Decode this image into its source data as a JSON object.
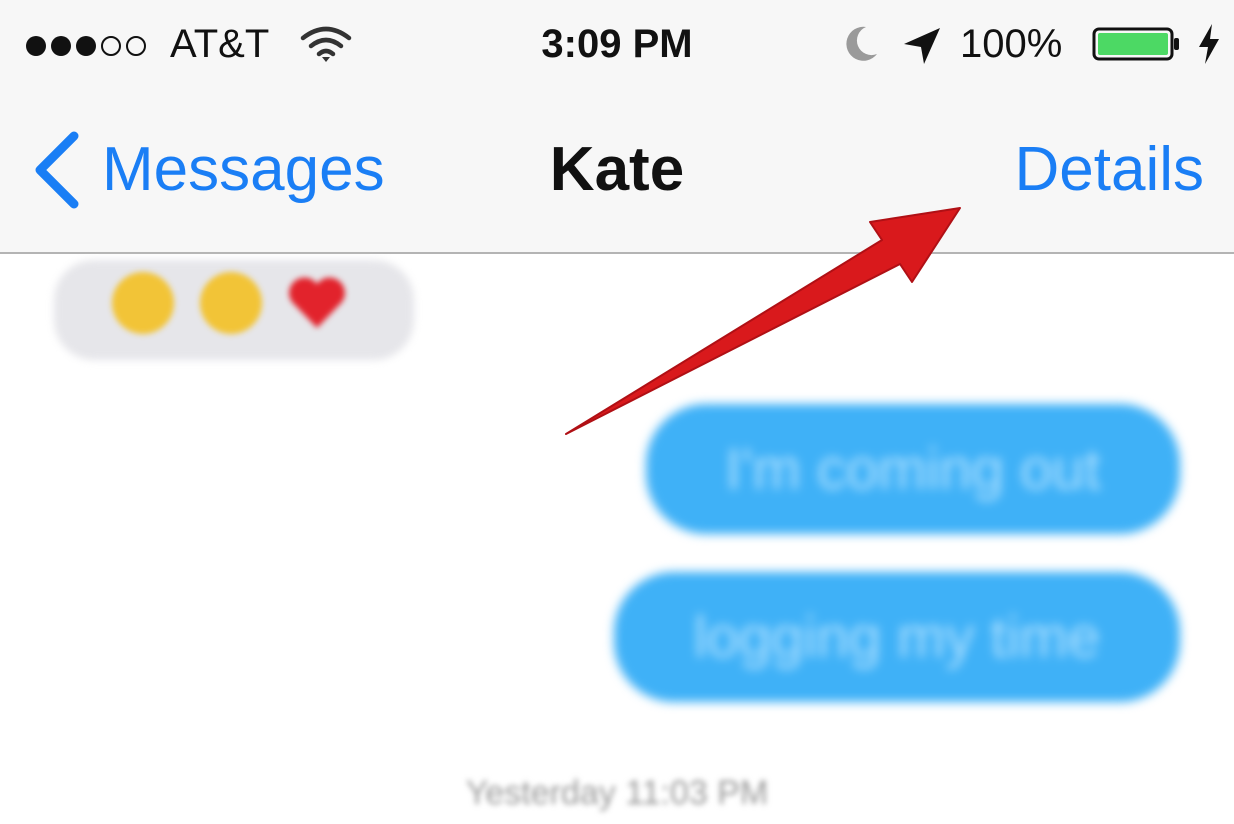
{
  "status_bar": {
    "signal_strength": "3 of 5",
    "carrier": "AT&T",
    "wifi_icon": "wifi-icon",
    "time": "3:09 PM",
    "do_not_disturb_icon": "moon-icon",
    "location_icon": "location-arrow-icon",
    "battery_percent": "100%",
    "battery_level": 1.0,
    "charging_icon": "lightning-bolt-icon"
  },
  "nav_bar": {
    "back_label": "Messages",
    "title": "Kate",
    "details_label": "Details"
  },
  "conversation": {
    "received": {
      "emojis": [
        "laughing-face",
        "smiling-face",
        "red-heart"
      ]
    },
    "sent": [
      {
        "text": "I'm coming out"
      },
      {
        "text": "logging my time"
      }
    ],
    "timestamp": "Yesterday 11:03 PM"
  },
  "colors": {
    "accent": "#1a7ef5",
    "sent_bubble": "#3fb1f7",
    "received_bubble": "#e6e6ea",
    "annotation_arrow": "#d9191c",
    "battery_fill": "#4cd964"
  }
}
